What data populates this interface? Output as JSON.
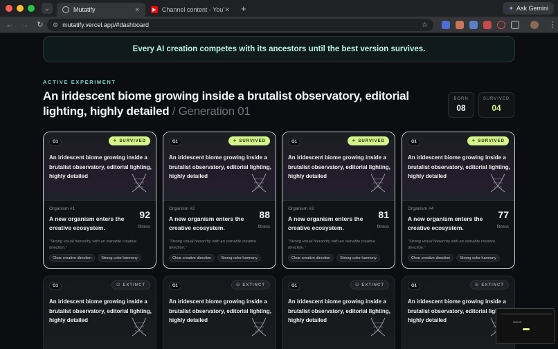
{
  "browser": {
    "tabs": [
      {
        "title": "Mutatify",
        "active": true
      },
      {
        "title": "Channel content - YouTube S",
        "active": false
      }
    ],
    "gemini_label": "Ask Gemini",
    "url": "mutatify.vercel.app/#dashboard"
  },
  "page": {
    "banner": "Every AI creation competes with its ancestors until the best version survives.",
    "eyebrow": "ACTIVE EXPERIMENT",
    "headline": "An iridescent biome growing inside a brutalist observatory, editorial lighting, highly detailed",
    "generation": "/ Generation 01",
    "stats": [
      {
        "label": "BORN",
        "value": "08",
        "color": "#f1f3f4"
      },
      {
        "label": "SURVIVED",
        "value": "04",
        "color": "#d4f58a"
      }
    ],
    "survivors": [
      {
        "gen": "G1",
        "status": "SURVIVED",
        "prompt": "An iridescent biome growing inside a brutalist observatory, editorial lighting, highly detailed",
        "organism": "Organism #1",
        "fitness": "92",
        "fitness_label": "fitness",
        "desc": "A new organism enters the creative ecosystem.",
        "quote": "“Strong visual hierarchy with an ownable creative direction.”",
        "tags": [
          "Clear creative direction",
          "Strong color harmony"
        ]
      },
      {
        "gen": "G1",
        "status": "SURVIVED",
        "prompt": "An iridescent biome growing inside a brutalist observatory, editorial lighting, highly detailed",
        "organism": "Organism #2",
        "fitness": "88",
        "fitness_label": "fitness",
        "desc": "A new organism enters the creative ecosystem.",
        "quote": "“Strong visual hierarchy with an ownable creative direction.”",
        "tags": [
          "Clear creative direction",
          "Strong color harmony"
        ]
      },
      {
        "gen": "G1",
        "status": "SURVIVED",
        "prompt": "An iridescent biome growing inside a brutalist observatory, editorial lighting, highly detailed",
        "organism": "Organism #3",
        "fitness": "81",
        "fitness_label": "fitness",
        "desc": "A new organism enters the creative ecosystem.",
        "quote": "“Strong visual hierarchy with an ownable creative direction.”",
        "tags": [
          "Clear creative direction",
          "Strong color harmony"
        ]
      },
      {
        "gen": "G1",
        "status": "SURVIVED",
        "prompt": "An iridescent biome growing inside a brutalist observatory, editorial lighting, highly detailed",
        "organism": "Organism #4",
        "fitness": "77",
        "fitness_label": "fitness",
        "desc": "A new organism enters the creative ecosystem.",
        "quote": "“Strong visual hierarchy with an ownable creative direction.”",
        "tags": [
          "Clear creative direction",
          "Strong color harmony"
        ]
      }
    ],
    "extinct": [
      {
        "gen": "G1",
        "status": "EXTINCT",
        "prompt": "An iridescent biome growing inside a brutalist observatory, editorial lighting, highly detailed"
      },
      {
        "gen": "G1",
        "status": "EXTINCT",
        "prompt": "An iridescent biome growing inside a brutalist observatory, editorial lighting, highly detailed"
      },
      {
        "gen": "G1",
        "status": "EXTINCT",
        "prompt": "An iridescent biome growing inside a brutalist observatory, editorial lighting, highly detailed"
      },
      {
        "gen": "G1",
        "status": "EXTINCT",
        "prompt": "An iridescent biome growing inside a brutalist observatory, editorial lighting, highly detailed"
      }
    ]
  },
  "colors": {
    "accent": "#d4f58a",
    "teal": "#7fd8c8",
    "bg": "#0b0d10"
  }
}
